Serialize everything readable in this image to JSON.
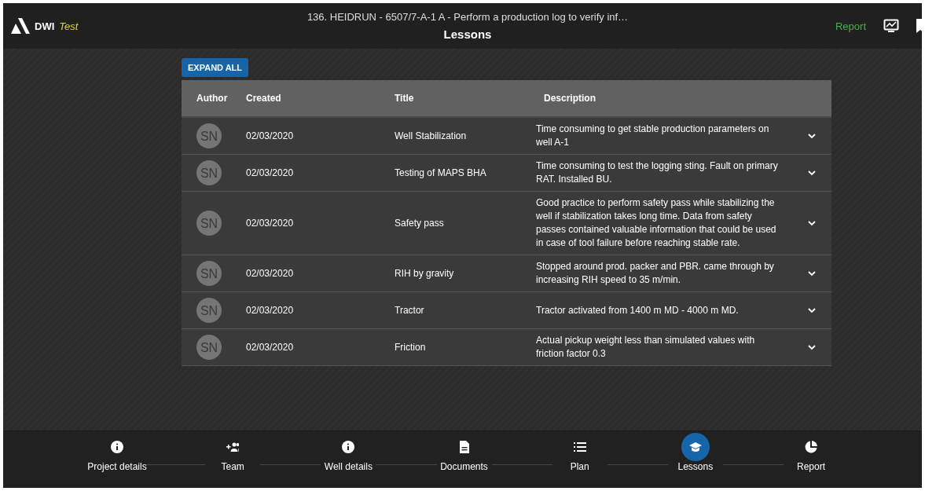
{
  "header": {
    "brand": "DWI",
    "environment": "Test",
    "subtitle": "136. HEIDRUN - 6507/7-A-1 A - Perform a production log to verify inf…",
    "title": "Lessons",
    "report_link": "Report"
  },
  "expand_button": "EXPAND ALL",
  "table": {
    "columns": [
      "Author",
      "Created",
      "Title",
      "Description"
    ],
    "rows": [
      {
        "author": "SN",
        "created": "02/03/2020",
        "title": "Well Stabilization",
        "description": "Time consuming to get stable production parameters on well A-1",
        "expanded": false
      },
      {
        "author": "SN",
        "created": "02/03/2020",
        "title": "Testing of MAPS BHA",
        "description": "Time consuming to test the logging sting. Fault on primary RAT. Installed BU.",
        "expanded": false
      },
      {
        "author": "SN",
        "created": "02/03/2020",
        "title": "Safety pass",
        "description": "Good practice to perform safety pass while stabilizing the well if stabilization takes long time. Data from safety passes contained valuable information that could be used in case of tool failure before reaching stable rate.",
        "expanded": false
      },
      {
        "author": "SN",
        "created": "02/03/2020",
        "title": "RIH by gravity",
        "description": "Stopped around prod. packer and PBR. came through by increasing RIH speed to 35 m/min.",
        "expanded": false
      },
      {
        "author": "SN",
        "created": "02/03/2020",
        "title": "Tractor",
        "description": "Tractor activated from 1400 m MD - 4000 m MD.",
        "expanded": false
      },
      {
        "author": "SN",
        "created": "02/03/2020",
        "title": "Friction",
        "description": "Actual pickup weight less than simulated values with friction factor 0.3",
        "expanded": false
      }
    ]
  },
  "steps": [
    {
      "label": "Project details",
      "kind": "info",
      "selected": false
    },
    {
      "label": "Team",
      "kind": "team",
      "selected": false
    },
    {
      "label": "Well details",
      "kind": "info",
      "selected": false
    },
    {
      "label": "Documents",
      "kind": "document",
      "selected": false
    },
    {
      "label": "Plan",
      "kind": "list",
      "selected": false
    },
    {
      "label": "Lessons",
      "kind": "school",
      "selected": true
    },
    {
      "label": "Report",
      "kind": "pie",
      "selected": false
    }
  ]
}
